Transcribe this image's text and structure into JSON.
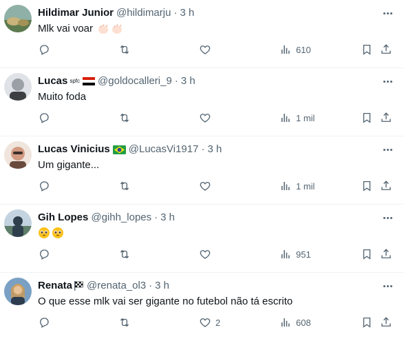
{
  "tweets": [
    {
      "name": "Hildimar Junior",
      "handle": "@hildimarju",
      "dot": "·",
      "time": "3 h",
      "text": "Mlk vai voar",
      "text_emoji": "clapping-hands-emoji x2",
      "badge": "",
      "likes": "",
      "views": "610",
      "avatar_colors": [
        "#7a9b8c",
        "#c9b37a",
        "#4f6a4e"
      ]
    },
    {
      "name": "Lucas",
      "handle": "@goldocalleri_9",
      "dot": "·",
      "time": "3 h",
      "text": "Muito foda",
      "badge": "spfc",
      "likes": "",
      "views": "1 mil",
      "avatar_colors": [
        "#d7dbe0",
        "#8e949a",
        "#3d3f43"
      ]
    },
    {
      "name": "Lucas Vinicius",
      "handle": "@LucasVi1917",
      "dot": "·",
      "time": "3 h",
      "text": "Um gigante...",
      "badge": "brazil-flag",
      "likes": "",
      "views": "1 mil",
      "avatar_colors": [
        "#e8d7cc",
        "#c98f7a",
        "#6b4a3e"
      ]
    },
    {
      "name": "Gih Lopes",
      "handle": "@gihh_lopes",
      "dot": "·",
      "time": "3 h",
      "text": "",
      "text_emoji": "pleading-face-emoji x2",
      "badge": "",
      "likes": "",
      "views": "951",
      "avatar_colors": [
        "#b5c7d8",
        "#5f7e6b",
        "#2f3f4c"
      ]
    },
    {
      "name": "Renata",
      "handle": "@renata_ol3",
      "dot": "·",
      "time": "3 h",
      "text": "O que esse mlk vai ser gigante no futebol não tá escrito",
      "badge": "checkered-flag",
      "likes": "2",
      "views": "608",
      "avatar_colors": [
        "#7aa0c4",
        "#d8b074",
        "#2e3c4f"
      ]
    }
  ],
  "colors": {
    "text": "#0f1419",
    "secondary": "#536471",
    "divider": "#eff3f4"
  },
  "icons": [
    "reply-icon",
    "retweet-icon",
    "like-icon",
    "views-icon",
    "bookmark-icon",
    "share-icon",
    "more-icon"
  ]
}
